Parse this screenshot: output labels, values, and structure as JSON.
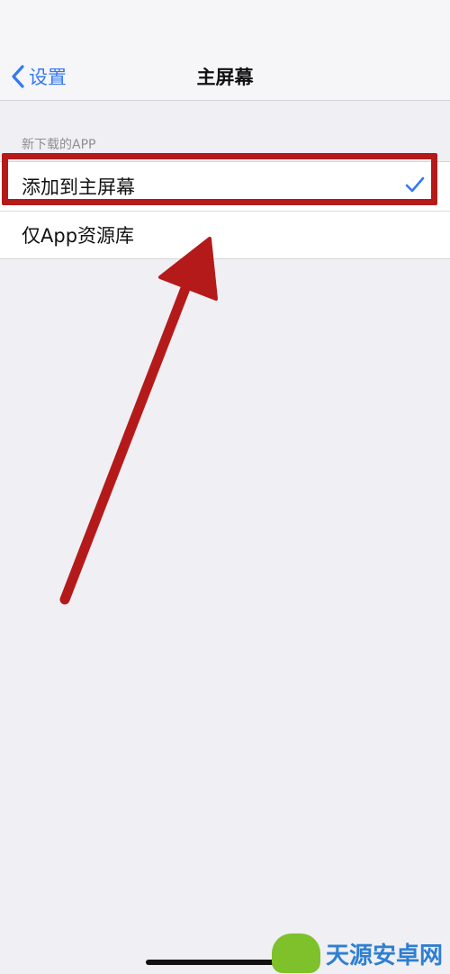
{
  "nav": {
    "back_label": "设置",
    "title": "主屏幕"
  },
  "section": {
    "header": "新下载的APP",
    "options": [
      {
        "label": "添加到主屏幕",
        "selected": true
      },
      {
        "label": "仅App资源库",
        "selected": false
      }
    ]
  },
  "colors": {
    "accent": "#3478f6",
    "annotation": "#b51a1a",
    "background": "#efeff4"
  },
  "icons": [
    "chevron-left-icon",
    "checkmark-icon",
    "annotation-arrow-icon"
  ],
  "watermark": {
    "text": "天源安卓网",
    "url": "www.jytyaz.com"
  }
}
